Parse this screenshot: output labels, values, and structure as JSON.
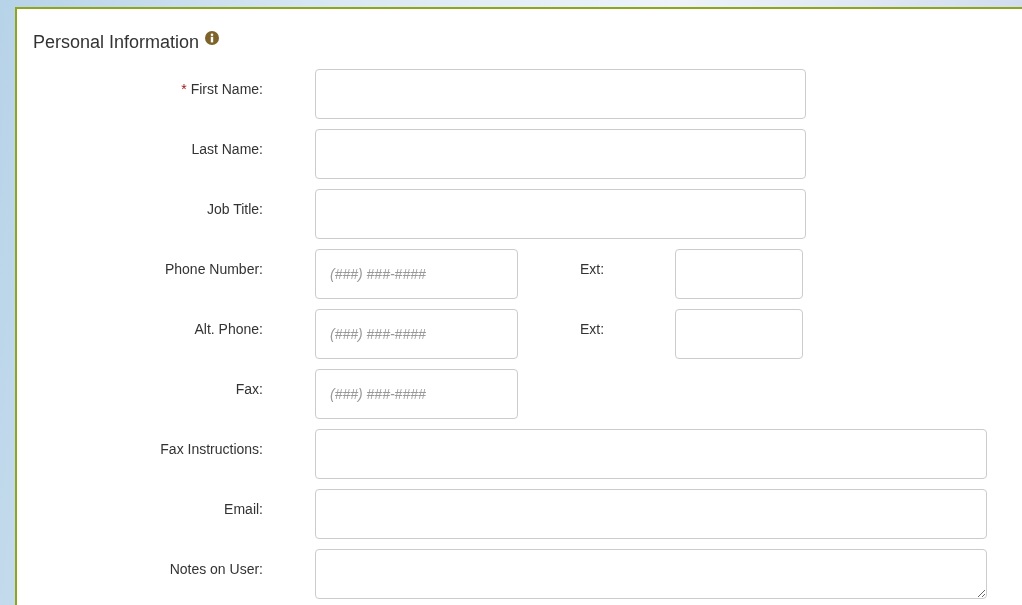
{
  "section": {
    "title": "Personal Information"
  },
  "fields": [
    {
      "kind": "text",
      "label": "First Name:",
      "required_mark": "*"
    },
    {
      "kind": "text",
      "label": "Last Name:"
    },
    {
      "kind": "text",
      "label": "Job Title:"
    },
    {
      "kind": "phone",
      "label": "Phone Number:",
      "placeholder": "(###) ###-####",
      "ext_label": "Ext:"
    },
    {
      "kind": "phone",
      "label": "Alt. Phone:",
      "placeholder": "(###) ###-####",
      "ext_label": "Ext:"
    },
    {
      "kind": "phone",
      "label": "Fax:",
      "placeholder": "(###) ###-####"
    },
    {
      "kind": "long_text",
      "label": "Fax Instructions:"
    },
    {
      "kind": "long_text",
      "label": "Email:"
    },
    {
      "kind": "textarea",
      "label": "Notes on User:"
    }
  ]
}
